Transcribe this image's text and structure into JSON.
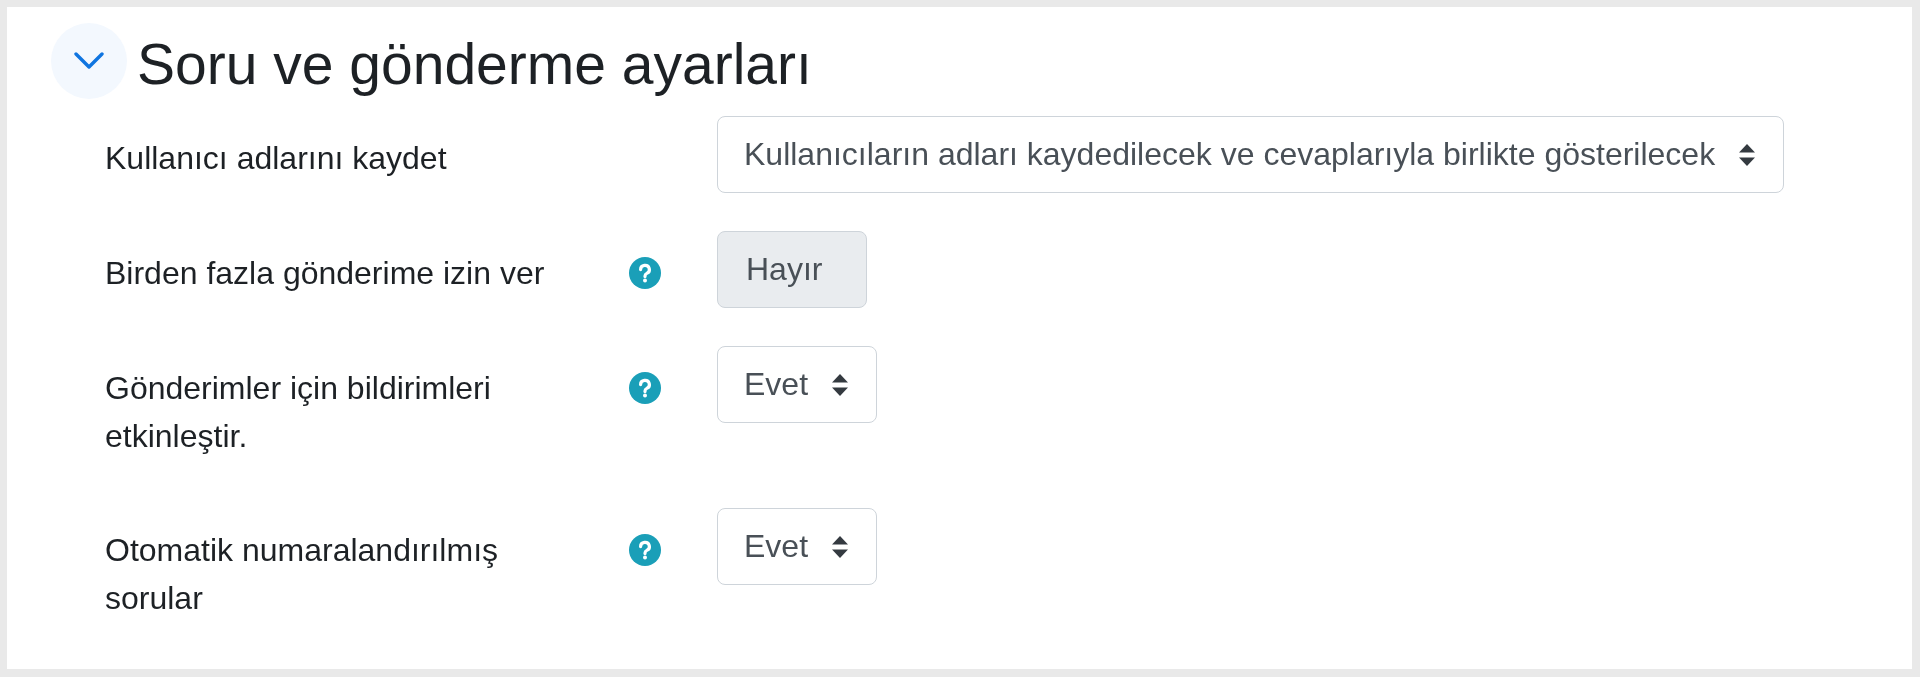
{
  "section": {
    "title": "Soru ve gönderme ayarları",
    "expanded": true
  },
  "fields": [
    {
      "label": "Kullanıcı adlarını kaydet",
      "help": false,
      "value": "Kullanıcıların adları kaydedilecek ve cevaplarıyla birlikte gösterilecek",
      "disabled": false
    },
    {
      "label": "Birden fazla gönderime izin ver",
      "help": true,
      "value": "Hayır",
      "disabled": true
    },
    {
      "label": "Gönderimler için bildirimleri etkinleştir.",
      "help": true,
      "value": "Evet",
      "disabled": false
    },
    {
      "label": "Otomatik numaralandırılmış sorular",
      "help": true,
      "value": "Evet",
      "disabled": false
    }
  ]
}
